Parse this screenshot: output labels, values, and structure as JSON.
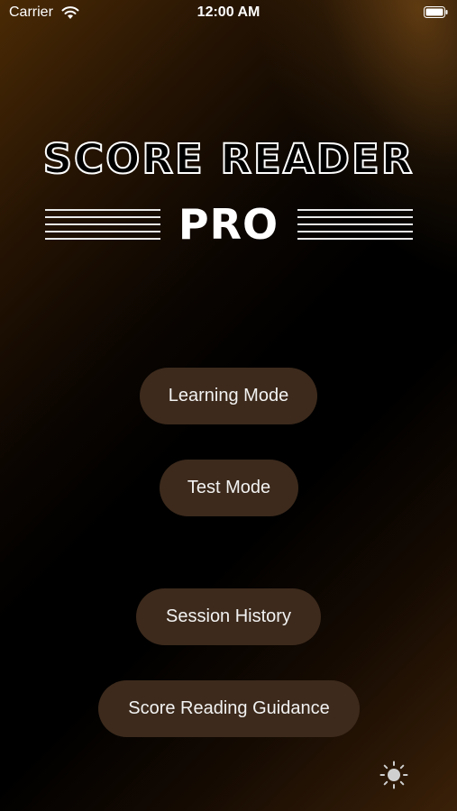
{
  "status_bar": {
    "carrier": "Carrier",
    "time": "12:00 AM",
    "wifi_icon": "wifi-icon",
    "battery_icon": "battery-icon"
  },
  "logo": {
    "title": "Score Reader",
    "subtitle": "PRO"
  },
  "menu": {
    "learning_mode": "Learning Mode",
    "test_mode": "Test Mode",
    "session_history": "Session History",
    "score_reading_guidance": "Score Reading Guidance"
  },
  "footer": {
    "theme_icon": "brightness-icon"
  },
  "colors": {
    "button_bg": "#3d2a1c",
    "text": "#ffffff",
    "background_accent": "#4a2a05"
  }
}
